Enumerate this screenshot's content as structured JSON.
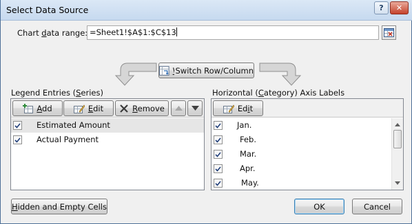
{
  "window": {
    "title": "Select Data Source",
    "help_glyph": "?",
    "close_glyph": "✕"
  },
  "range": {
    "label_pre": "Chart ",
    "label_u": "d",
    "label_post": "ata range:",
    "value": "=Sheet1!$A$1:$C$13"
  },
  "switch": {
    "label_u": "W",
    "label_rest": "Switch Row/Column"
  },
  "legend": {
    "title_pre": "Legend Entries (",
    "title_u": "S",
    "title_post": "eries)",
    "add_u": "A",
    "add_rest": "dd",
    "edit_u": "E",
    "edit_rest": "dit",
    "remove_u": "R",
    "remove_rest": "emove",
    "series": [
      {
        "label": "Estimated Amount",
        "checked": true,
        "selected": true
      },
      {
        "label": "Actual Payment",
        "checked": true,
        "selected": false
      }
    ]
  },
  "axis": {
    "title_pre": "Horizontal (",
    "title_u": "C",
    "title_post": "ategory) Axis Labels",
    "edit_pre": "Ed",
    "edit_u": "i",
    "edit_post": "t",
    "categories": [
      {
        "label": "Jan.",
        "checked": true
      },
      {
        "label": "Feb.",
        "checked": true
      },
      {
        "label": "Mar.",
        "checked": true
      },
      {
        "label": "Apr.",
        "checked": true
      },
      {
        "label": "May.",
        "checked": true
      }
    ]
  },
  "footer": {
    "hidden_u": "H",
    "hidden_rest": "idden and Empty Cells",
    "ok_label": "OK",
    "cancel_label": "Cancel"
  }
}
